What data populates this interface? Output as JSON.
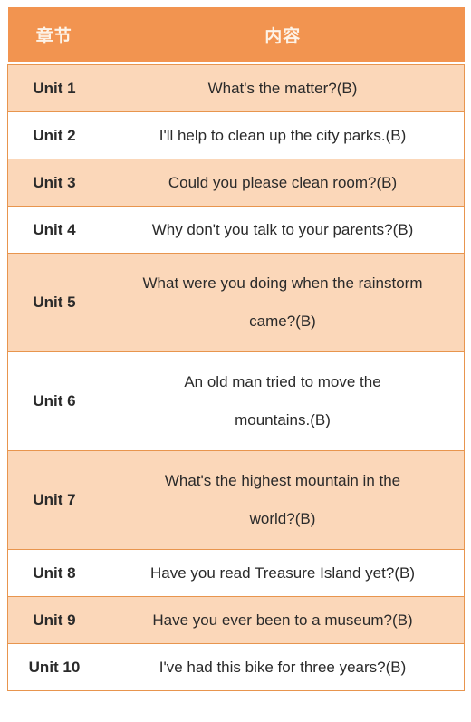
{
  "table": {
    "headers": {
      "chapter": "章节",
      "content": "内容"
    },
    "colors": {
      "header_background": "#F29450",
      "header_text": "#FDF3E7",
      "row_tint": "#FBD7B9",
      "row_plain": "#FFFFFF",
      "border": "#E8954E",
      "body_text": "#2a2a2a"
    },
    "rows": [
      {
        "chapter": "Unit 1",
        "content": "What's the matter?(B)",
        "lines": [
          "What's the matter?(B)"
        ],
        "tinted": true,
        "double": false
      },
      {
        "chapter": "Unit 2",
        "content": "I'll help to clean up the city parks.(B)",
        "lines": [
          "I'll help to clean up the city parks.(B)"
        ],
        "tinted": false,
        "double": false
      },
      {
        "chapter": "Unit 3",
        "content": "Could you please clean room?(B)",
        "lines": [
          "Could you please clean room?(B)"
        ],
        "tinted": true,
        "double": false
      },
      {
        "chapter": "Unit 4",
        "content": "Why don't you talk to your parents?(B)",
        "lines": [
          "Why don't you talk to your parents?(B)"
        ],
        "tinted": false,
        "double": false
      },
      {
        "chapter": "Unit 5",
        "content": "What were you doing when the rainstorm came?(B)",
        "lines": [
          "What were you doing when the rainstorm",
          "came?(B)"
        ],
        "tinted": true,
        "double": true
      },
      {
        "chapter": "Unit 6",
        "content": "An old man tried to move the mountains.(B)",
        "lines": [
          "An old man tried to move the",
          "mountains.(B)"
        ],
        "tinted": false,
        "double": true
      },
      {
        "chapter": "Unit 7",
        "content": "What's the highest mountain in the world?(B)",
        "lines": [
          "What's the highest mountain in the",
          "world?(B)"
        ],
        "tinted": true,
        "double": true
      },
      {
        "chapter": "Unit 8",
        "content": "Have you read Treasure Island yet?(B)",
        "lines": [
          "Have you read Treasure Island yet?(B)"
        ],
        "tinted": false,
        "double": false
      },
      {
        "chapter": "Unit 9",
        "content": "Have you ever been to a museum?(B)",
        "lines": [
          "Have you ever been to a museum?(B)"
        ],
        "tinted": true,
        "double": false
      },
      {
        "chapter": "Unit 10",
        "content": "I've had this bike for three years?(B)",
        "lines": [
          "I've had this bike for three years?(B)"
        ],
        "tinted": false,
        "double": false
      }
    ]
  }
}
